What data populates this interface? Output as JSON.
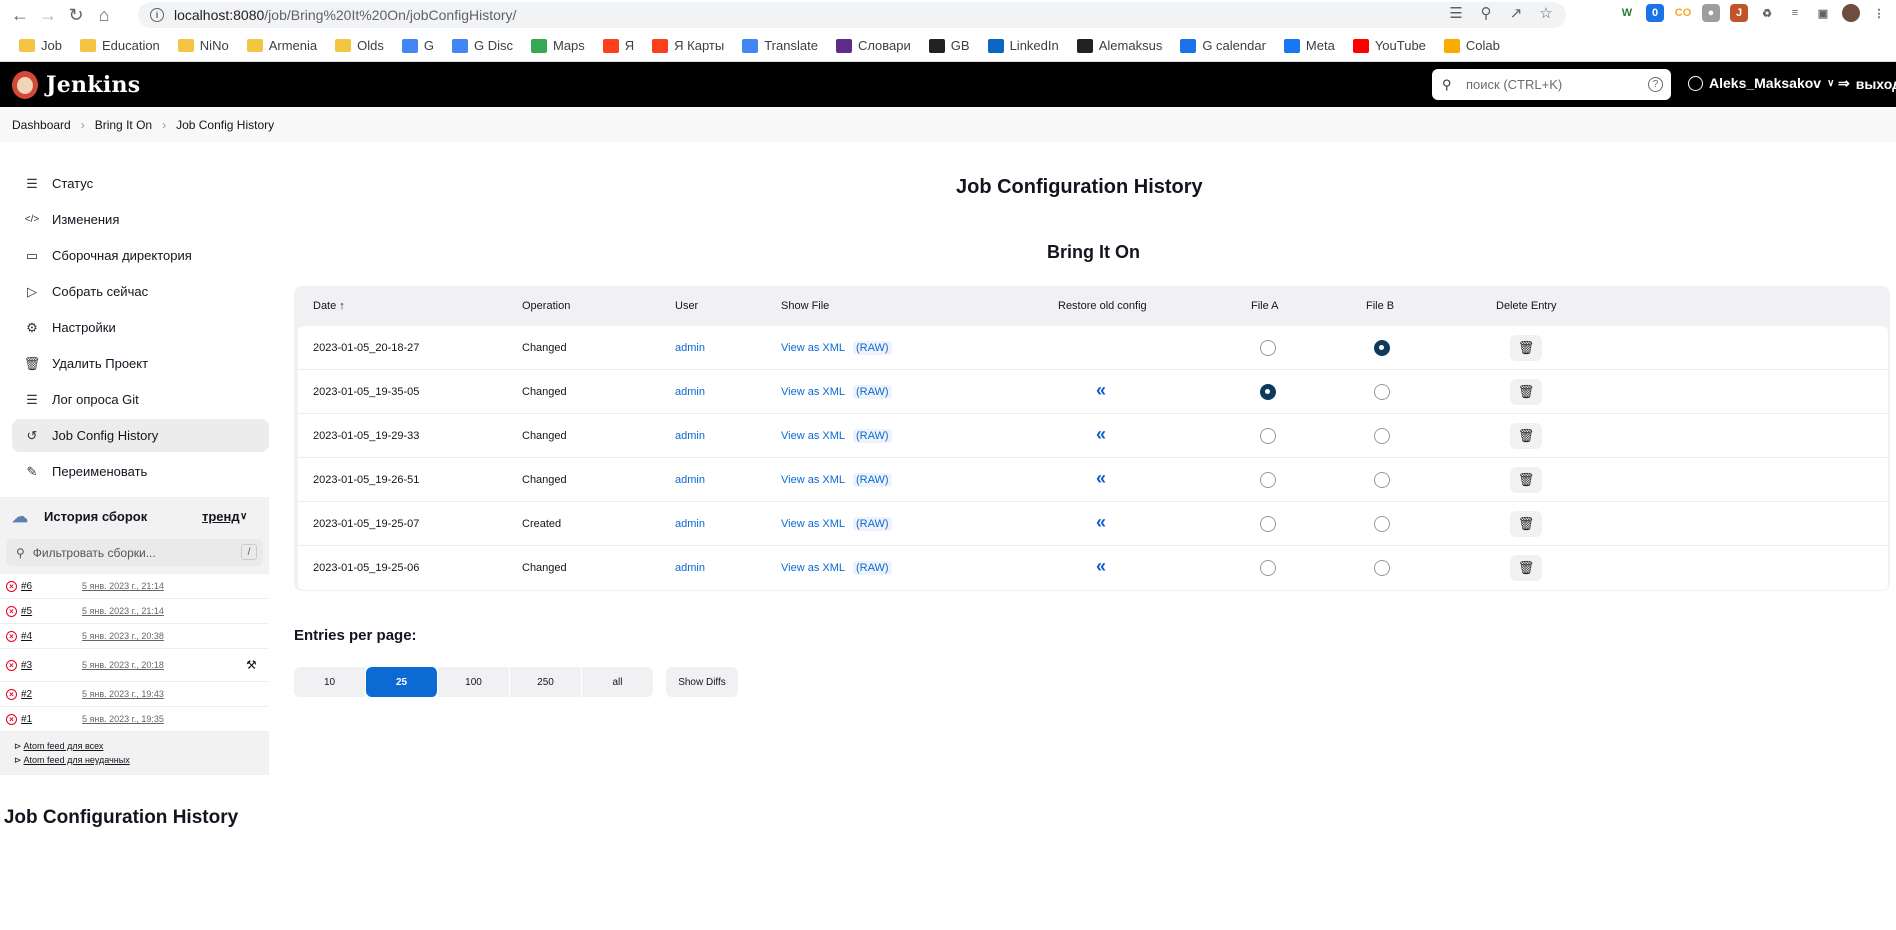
{
  "browser": {
    "url_host": "localhost:8080",
    "url_path": "/job/Bring%20It%20On/jobConfigHistory/",
    "bookmarks": [
      {
        "label": "Job",
        "icon": "folder-icon"
      },
      {
        "label": "Education",
        "icon": "folder-icon"
      },
      {
        "label": "NiNo",
        "icon": "folder-icon"
      },
      {
        "label": "Armenia",
        "icon": "folder-icon"
      },
      {
        "label": "Olds",
        "icon": "folder-icon"
      },
      {
        "label": "G",
        "icon": "google-icon"
      },
      {
        "label": "G Disc",
        "icon": "google-icon"
      },
      {
        "label": "Maps",
        "icon": "maps-icon"
      },
      {
        "label": "Я",
        "icon": "yandex-icon"
      },
      {
        "label": "Я Карты",
        "icon": "yandex-maps-icon"
      },
      {
        "label": "Translate",
        "icon": "translate-icon"
      },
      {
        "label": "Словари",
        "icon": "dictionary-icon"
      },
      {
        "label": "GB",
        "icon": "openai-icon"
      },
      {
        "label": "LinkedIn",
        "icon": "linkedin-icon"
      },
      {
        "label": "Alemaksus",
        "icon": "github-icon"
      },
      {
        "label": "G calendar",
        "icon": "calendar-icon"
      },
      {
        "label": "Meta",
        "icon": "facebook-icon"
      },
      {
        "label": "YouTube",
        "icon": "youtube-icon"
      },
      {
        "label": "Colab",
        "icon": "colab-icon"
      }
    ]
  },
  "header": {
    "brand": "Jenkins",
    "search_placeholder": "поиск (CTRL+K)",
    "user": "Aleks_Maksakov",
    "logout": "выход"
  },
  "breadcrumbs": [
    "Dashboard",
    "Bring It On",
    "Job Config History"
  ],
  "sidebar": {
    "items": [
      {
        "label": "Статус",
        "icon": "document-icon"
      },
      {
        "label": "Изменения",
        "icon": "code-icon"
      },
      {
        "label": "Сборочная директория",
        "icon": "folder-icon"
      },
      {
        "label": "Собрать сейчас",
        "icon": "play-icon"
      },
      {
        "label": "Настройки",
        "icon": "gear-icon"
      },
      {
        "label": "Удалить Проект",
        "icon": "trash-icon"
      },
      {
        "label": "Лог опроса Git",
        "icon": "document-icon"
      },
      {
        "label": "Job Config History",
        "icon": "history-icon"
      },
      {
        "label": "Переименовать",
        "icon": "pencil-icon"
      }
    ],
    "build_history": {
      "title": "История сборок",
      "trend": "тренд",
      "filter_placeholder": "Фильтровать сборки...",
      "filter_shortcut": "/",
      "builds": [
        {
          "num": "#6",
          "date": "5 янв. 2023 г., 21:14"
        },
        {
          "num": "#5",
          "date": "5 янв. 2023 г., 21:14"
        },
        {
          "num": "#4",
          "date": "5 янв. 2023 г., 20:38"
        },
        {
          "num": "#3",
          "date": "5 янв. 2023 г., 20:18"
        },
        {
          "num": "#2",
          "date": "5 янв. 2023 г., 19:43"
        },
        {
          "num": "#1",
          "date": "5 янв. 2023 г., 19:35"
        }
      ],
      "feed_all": "Atom feed для всех",
      "feed_failed": "Atom feed для неудачных"
    },
    "bottom_title": "Job Configuration History"
  },
  "main": {
    "title": "Job Configuration History",
    "subtitle": "Bring It On",
    "columns": [
      "Date ↑",
      "Operation",
      "User",
      "Show File",
      "Restore old config",
      "File A",
      "File B",
      "Delete Entry"
    ],
    "rows": [
      {
        "date": "2023-01-05_20-18-27",
        "operation": "Changed",
        "user": "admin",
        "view": "View as XML",
        "raw": "(RAW)",
        "restore": false,
        "fileA": false,
        "fileB": true
      },
      {
        "date": "2023-01-05_19-35-05",
        "operation": "Changed",
        "user": "admin",
        "view": "View as XML",
        "raw": "(RAW)",
        "restore": true,
        "fileA": true,
        "fileB": false
      },
      {
        "date": "2023-01-05_19-29-33",
        "operation": "Changed",
        "user": "admin",
        "view": "View as XML",
        "raw": "(RAW)",
        "restore": true,
        "fileA": false,
        "fileB": false
      },
      {
        "date": "2023-01-05_19-26-51",
        "operation": "Changed",
        "user": "admin",
        "view": "View as XML",
        "raw": "(RAW)",
        "restore": true,
        "fileA": false,
        "fileB": false
      },
      {
        "date": "2023-01-05_19-25-07",
        "operation": "Created",
        "user": "admin",
        "view": "View as XML",
        "raw": "(RAW)",
        "restore": true,
        "fileA": false,
        "fileB": false
      },
      {
        "date": "2023-01-05_19-25-06",
        "operation": "Changed",
        "user": "admin",
        "view": "View as XML",
        "raw": "(RAW)",
        "restore": true,
        "fileA": false,
        "fileB": false
      }
    ],
    "entries_label": "Entries per page:",
    "page_sizes": [
      "10",
      "25",
      "100",
      "250",
      "all"
    ],
    "selected_page_size": "25",
    "show_diffs": "Show Diffs"
  }
}
